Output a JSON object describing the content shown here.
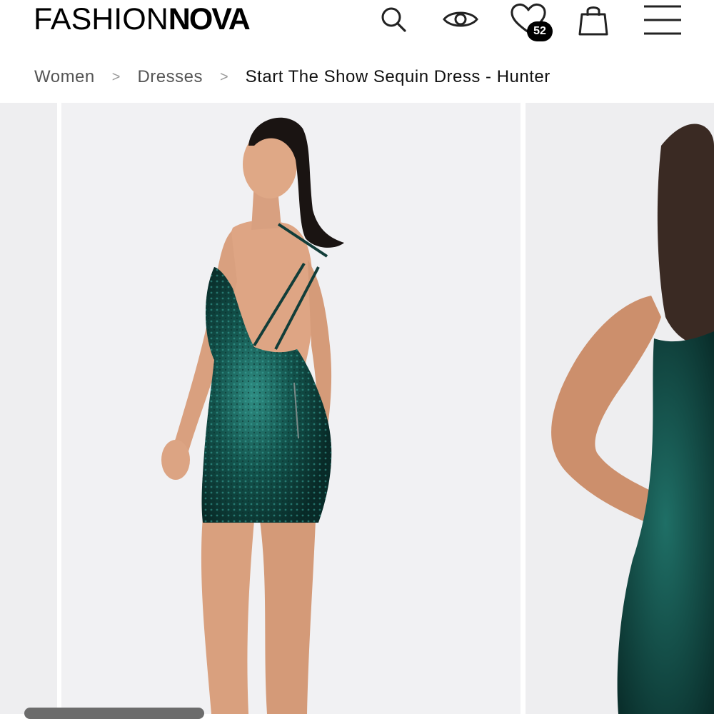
{
  "header": {
    "logo_light": "FASHION",
    "logo_bold": "NOVA",
    "icons": [
      "search-icon",
      "eye-icon",
      "heart-icon",
      "shopping-bag-icon",
      "menu-icon"
    ],
    "wishlist_count": "52"
  },
  "breadcrumb": {
    "items": [
      "Women",
      "Dresses",
      "Start The Show Sequin Dress - Hunter"
    ],
    "separator": ">"
  },
  "gallery": {
    "dress_color": "#0f4a44",
    "images": [
      "product-image-back",
      "product-image-side"
    ]
  }
}
